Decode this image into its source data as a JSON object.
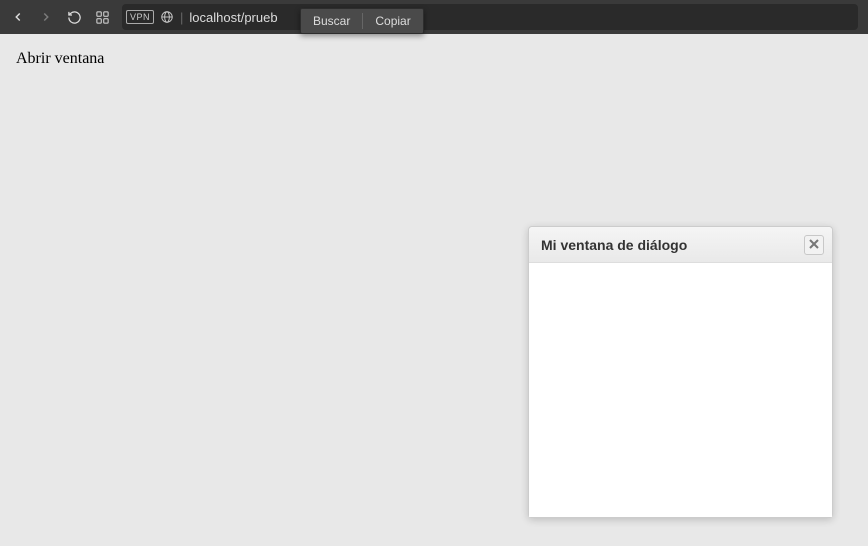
{
  "browser": {
    "vpn_badge": "VPN",
    "url": "localhost/prueb"
  },
  "context_menu": {
    "items": [
      "Buscar",
      "Copiar"
    ]
  },
  "page": {
    "open_link_text": "Abrir ventana"
  },
  "dialog": {
    "title": "Mi ventana de diálogo"
  }
}
